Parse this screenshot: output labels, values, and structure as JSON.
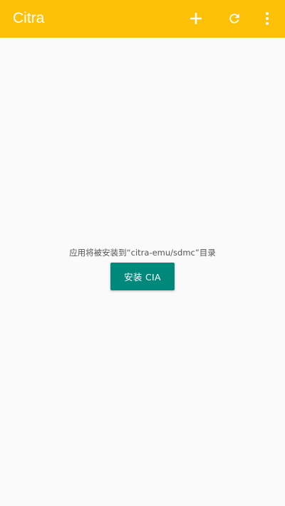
{
  "app_bar": {
    "title": "Citra",
    "background_color": "#ffc107",
    "actions": [
      {
        "icon": "add-icon"
      },
      {
        "icon": "refresh-icon"
      },
      {
        "icon": "more-vert-icon"
      }
    ]
  },
  "main": {
    "message": "应用将被安装到“citra-emu/sdmc”目录",
    "install_button_label": "安装 CIA",
    "button_color": "#00897b"
  }
}
